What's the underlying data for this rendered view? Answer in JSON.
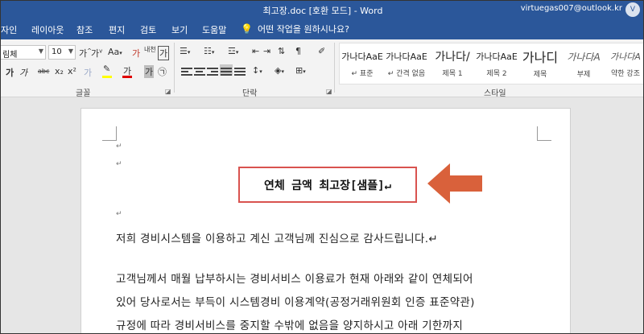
{
  "window": {
    "title": "최고장.doc [호환 모드] - Word",
    "account": "virtuegas007@outlook.kr",
    "avatar_letter": "V"
  },
  "tabs": [
    {
      "label": "자인"
    },
    {
      "label": "레이아웃"
    },
    {
      "label": "참조"
    },
    {
      "label": "편지"
    },
    {
      "label": "검토"
    },
    {
      "label": "보기"
    },
    {
      "label": "도움말"
    }
  ],
  "tell_me": "어떤 작업을 원하시나요?",
  "font": {
    "name": "림체",
    "size": "10",
    "grow": "가",
    "shrink": "가",
    "case": "Aa",
    "clear": "가",
    "phonetic": "내천",
    "border": "가",
    "bold": "가",
    "italic": "가",
    "strike": "abc",
    "sub": "x₂",
    "sup": "x²",
    "effects": "가",
    "highlight": "가",
    "color": "가",
    "shade": "가",
    "enclose": "㉠",
    "group_label": "글꼴"
  },
  "paragraph": {
    "group_label": "단락"
  },
  "styles": {
    "group_label": "스타일",
    "items": [
      {
        "preview": "가나다AaE",
        "name": "↵ 표준"
      },
      {
        "preview": "가나다AaE",
        "name": "↵ 간격 없음"
      },
      {
        "preview": "가나다/",
        "name": "제목 1"
      },
      {
        "preview": "가나다AaE",
        "name": "제목 2"
      },
      {
        "preview": "가나디",
        "name": "제목"
      },
      {
        "preview": "가나다A",
        "name": "부제"
      },
      {
        "preview": "가나다A",
        "name": "약한 강조"
      }
    ]
  },
  "colors": {
    "accent": "#2b579a",
    "highlight_yellow": "#ffff00",
    "font_red": "#e00000",
    "annotation": "#d9534f"
  },
  "document": {
    "para_mark": "↵",
    "title": "연체 금액 최고장[샘플]↵",
    "lines": [
      "저희 경비시스템을 이용하고 계신 고객님께 진심으로 감사드립니다.↵",
      "고객님께서 매월 납부하시는 경비서비스 이용료가 현재 아래와 같이 연체되어",
      "있어 당사로서는 부득이 시스템경비 이용계약(공정거래위원회 인증 표준약관)",
      "규정에 따라 경비서비스를 중지할 수밖에 없음을 양지하시고 아래 기한까지"
    ]
  }
}
